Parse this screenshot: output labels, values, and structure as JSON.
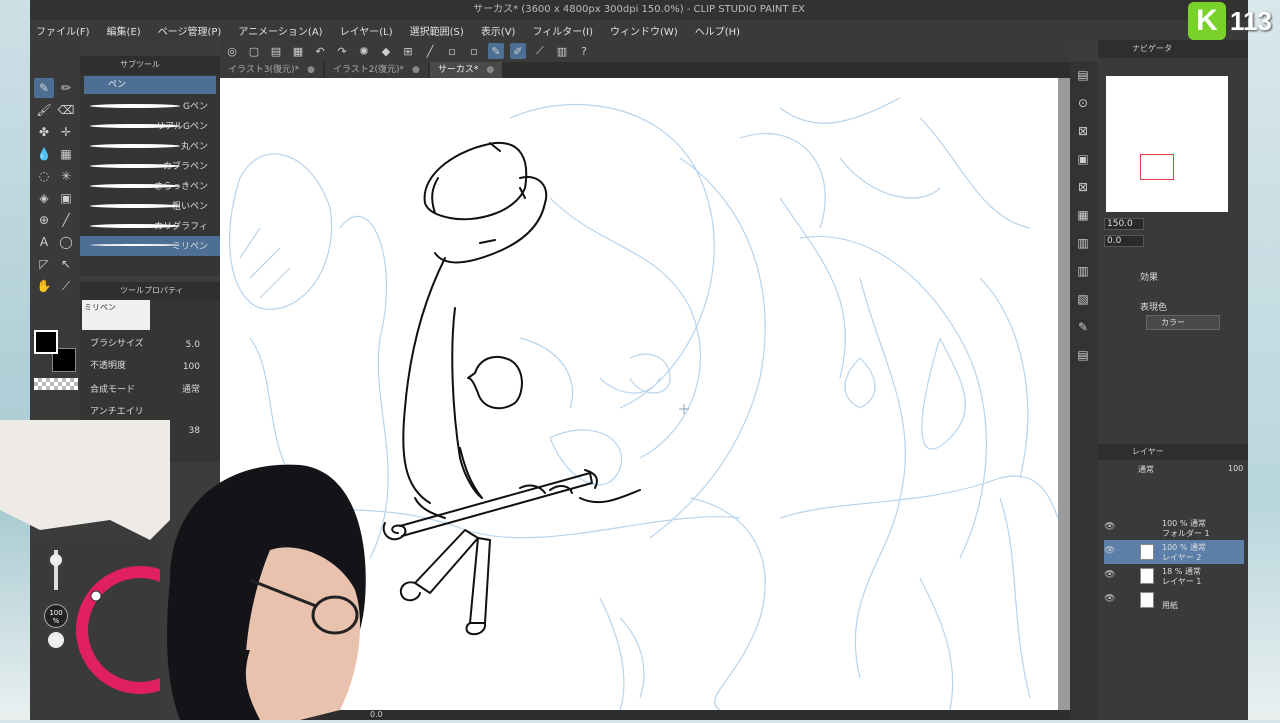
{
  "app": {
    "title": "サーカス* (3600 x 4800px 300dpi 150.0%) - CLIP STUDIO PAINT EX"
  },
  "menu": [
    "ファイル(F)",
    "編集(E)",
    "ページ管理(P)",
    "アニメーション(A)",
    "レイヤー(L)",
    "選択範囲(S)",
    "表示(V)",
    "フィルター(I)",
    "ウィンドウ(W)",
    "ヘルプ(H)"
  ],
  "tabs": [
    {
      "label": "イラスト3(復元)*",
      "close": "●"
    },
    {
      "label": "イラスト2(復元)*",
      "close": "●"
    },
    {
      "label": "サーカス*",
      "close": "●"
    }
  ],
  "subtool": {
    "header": "サブツール",
    "group": "ペン",
    "brushes": [
      "Gペン",
      "リアルGペン",
      "丸ペン",
      "カブラペン",
      "さらっきペン",
      "粗いペン",
      "カリグラフィ",
      "ミリペン"
    ]
  },
  "toolprops": {
    "header": "ツールプロパティ",
    "preset": "ミリペン",
    "brush_size_label": "ブラシサイズ",
    "brush_size": "5.0",
    "opacity_label": "不透明度",
    "opacity": "100",
    "blend_label": "合成モード",
    "blend": "通常",
    "aa_label": "アンチエイリ",
    "extra_value": "38"
  },
  "color": {
    "opacity_badge": "100 %"
  },
  "navigator": {
    "header": "ナビゲータ",
    "zoom": "150.0",
    "rotation": "0.0"
  },
  "effect": {
    "label": "効果"
  },
  "expression": {
    "label": "表現色",
    "value": "カラー"
  },
  "layers": {
    "header": "レイヤー",
    "blend": "通常",
    "opacity": "100",
    "items": [
      {
        "line1": "100 % 通常",
        "line2": "フォルダー 1"
      },
      {
        "line1": "100 % 通常",
        "line2": "レイヤー 2"
      },
      {
        "line1": "18 % 通常",
        "line2": "レイヤー 1"
      },
      {
        "line1": "",
        "line2": "用紙"
      }
    ]
  },
  "status": {
    "zoom": "0.0"
  },
  "overlay": {
    "brand_number": "113"
  }
}
